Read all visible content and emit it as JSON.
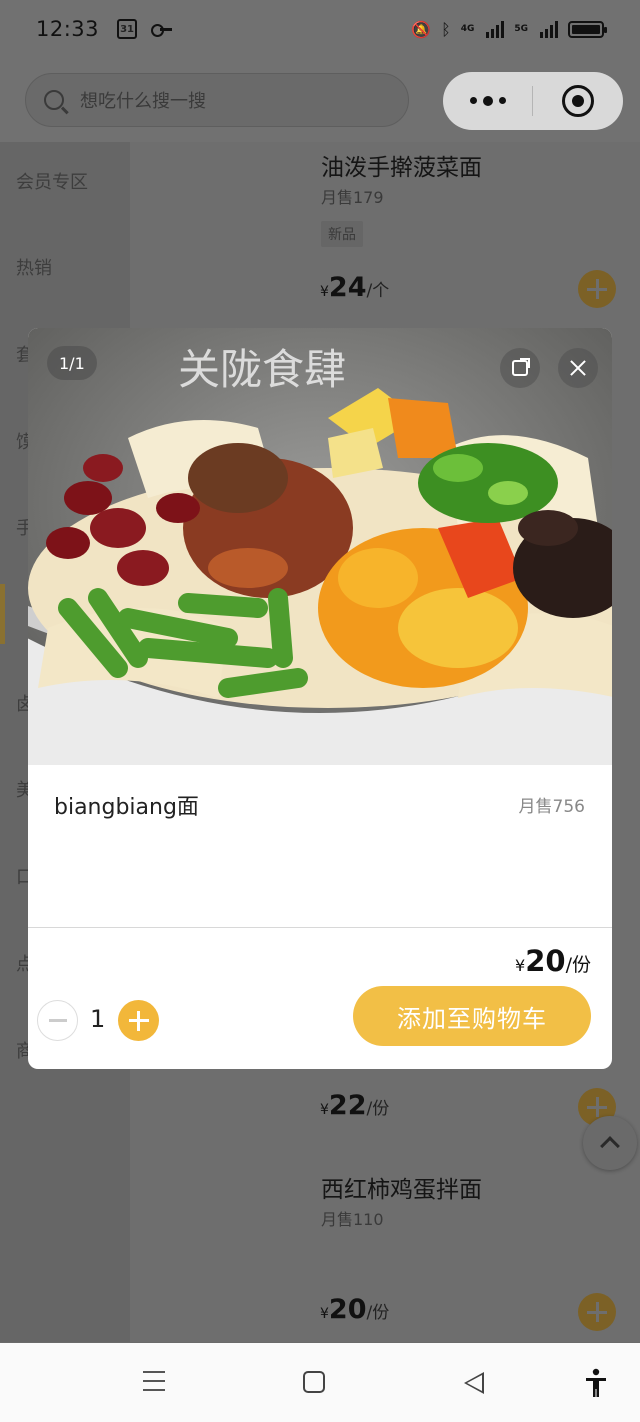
{
  "status_bar": {
    "time": "12:33",
    "calendar_day": "31",
    "signal1_label": "4G",
    "signal2_label": "5G"
  },
  "search": {
    "placeholder": "想吃什么搜一搜"
  },
  "sidebar": {
    "items": [
      {
        "label": "会员专区"
      },
      {
        "label": "热销"
      },
      {
        "label": "套"
      },
      {
        "label": "馍"
      },
      {
        "label": "手"
      },
      {
        "label": "卤"
      },
      {
        "label": "美"
      },
      {
        "label": "口"
      },
      {
        "label": "点"
      },
      {
        "label": "商"
      }
    ]
  },
  "products": [
    {
      "title": "油泼手擀菠菜面",
      "sales": "月售179",
      "tag": "新品",
      "currency": "¥",
      "price": "24",
      "unit": "/个"
    },
    {
      "currency": "¥",
      "price": "22",
      "unit": "/份"
    },
    {
      "title": "西红柿鸡蛋拌面",
      "sales": "月售110",
      "currency": "¥",
      "price": "20",
      "unit": "/份"
    }
  ],
  "modal": {
    "image_counter": "1/1",
    "image_watermark": "关陇食肆",
    "name": "biangbiang面",
    "sales": "月售756",
    "currency": "¥",
    "price": "20",
    "unit": "/份",
    "quantity": "1",
    "add_to_cart_label": "添加至购物车"
  },
  "colors": {
    "accent": "#F2BF46",
    "overlay": "#6B6B6B"
  }
}
